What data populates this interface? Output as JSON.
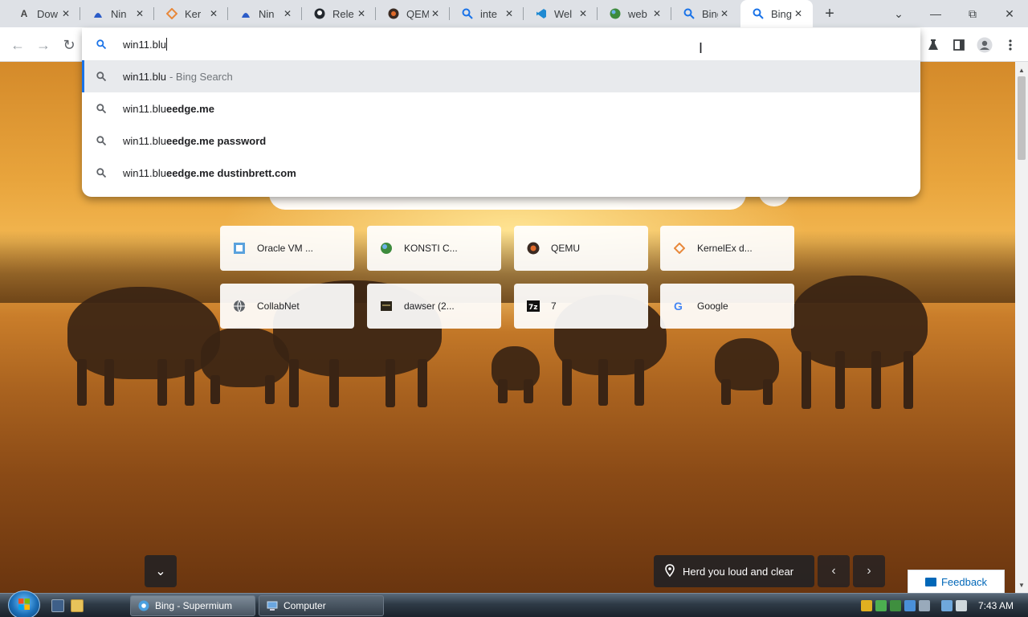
{
  "browser": {
    "tabs": [
      {
        "title": "Dow",
        "icon": "triangle-a-icon"
      },
      {
        "title": "Nin",
        "icon": "ninja-icon"
      },
      {
        "title": "Ker",
        "icon": "kernelex-icon"
      },
      {
        "title": "Nin",
        "icon": "ninja-icon"
      },
      {
        "title": "Rele",
        "icon": "github-icon"
      },
      {
        "title": "QEM",
        "icon": "qemu-icon"
      },
      {
        "title": "inte",
        "icon": "search-icon"
      },
      {
        "title": "Wel",
        "icon": "vscode-icon"
      },
      {
        "title": "web",
        "icon": "globe-icon"
      },
      {
        "title": "Bing",
        "icon": "search-icon"
      },
      {
        "title": "Bing",
        "icon": "search-icon",
        "active": true
      }
    ],
    "new_tab_symbol": "+",
    "window_controls": {
      "dropdown": "⌄",
      "minimize": "—",
      "restore": "⧉",
      "close": "✕"
    }
  },
  "toolbar": {
    "back": "←",
    "forward": "→",
    "reload": "↻"
  },
  "omnibox": {
    "value": "win11.blu",
    "suggestions": [
      {
        "typed": "win11.blu",
        "completion": "",
        "subtitle": "- Bing Search",
        "selected": true
      },
      {
        "typed": "win11.blu",
        "completion": "eedge.me",
        "subtitle": ""
      },
      {
        "typed": "win11.blu",
        "completion": "eedge.me password",
        "subtitle": ""
      },
      {
        "typed": "win11.blu",
        "completion": "eedge.me dustinbrett.com",
        "subtitle": ""
      }
    ]
  },
  "quick_links": [
    {
      "label": "Oracle VM ...",
      "icon": "virtualbox-icon"
    },
    {
      "label": "KONSTI C...",
      "icon": "globe-icon"
    },
    {
      "label": "QEMU",
      "icon": "qemu-icon"
    },
    {
      "label": "KernelEx d...",
      "icon": "kernelex-icon"
    },
    {
      "label": "CollabNet",
      "icon": "globe-icon"
    },
    {
      "label": "dawser (2...",
      "icon": "dawser-icon"
    },
    {
      "label": "7",
      "icon": "7zip-icon"
    },
    {
      "label": "Google",
      "icon": "google-icon"
    }
  ],
  "caption": "Herd you loud and clear",
  "feedback_label": "Feedback",
  "taskbar": {
    "buttons": [
      {
        "label": "Bing - Supermium",
        "active": true
      },
      {
        "label": "Computer",
        "active": false
      }
    ],
    "clock": "7:43 AM"
  }
}
